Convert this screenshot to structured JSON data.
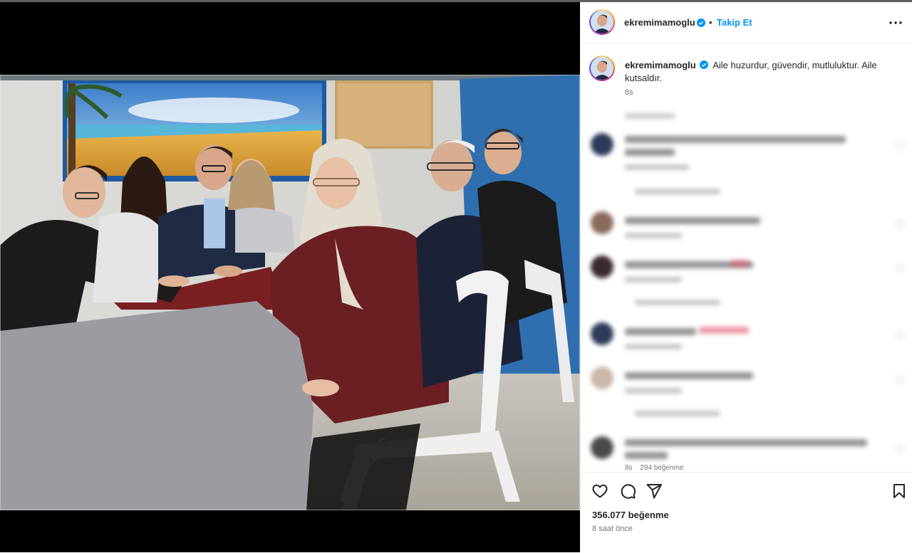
{
  "post": {
    "username": "ekremimamoglu",
    "separator": "•",
    "follow_label": "Takip Et",
    "caption": "Aile huzurdur, güvendir, mutluluktur. Aile kutsaldır.",
    "caption_time": "8s",
    "likes": "356.077 beğenme",
    "posted_ago": "8 saat önce",
    "peek_time": "8s",
    "peek_likes": "294 beğenme"
  },
  "colors": {
    "accent": "#0095f6",
    "text": "#262626",
    "muted": "#737373",
    "verified": "#0095f6"
  },
  "icons": {
    "verified": "verified-badge-icon",
    "more": "more-options-icon",
    "like": "heart-icon",
    "comment": "comment-icon",
    "share": "share-icon",
    "save": "bookmark-icon"
  }
}
